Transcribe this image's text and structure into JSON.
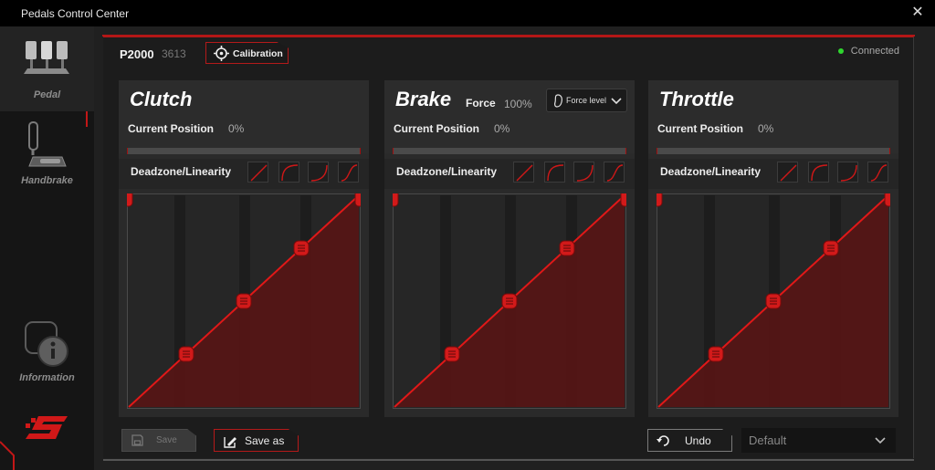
{
  "window": {
    "title": "Pedals Control Center",
    "close_icon": "close-icon"
  },
  "sidebar": {
    "items": [
      {
        "label": "Pedal",
        "icon": "pedals-icon",
        "active": true
      },
      {
        "label": "Handbrake",
        "icon": "handbrake-icon",
        "active": false
      },
      {
        "label": "Information",
        "icon": "information-icon",
        "active": false
      }
    ],
    "logo": "brand-logo"
  },
  "header": {
    "model": "P2000",
    "serial": "3613",
    "calibration_label": "Calibration",
    "status": "Connected",
    "status_color": "#2fd62f"
  },
  "panels": [
    {
      "title": "Clutch",
      "position_label": "Current Position",
      "position_value": "0%",
      "deadzone_label": "Deadzone/Linearity"
    },
    {
      "title": "Brake",
      "position_label": "Current Position",
      "position_value": "0%",
      "deadzone_label": "Deadzone/Linearity",
      "force_label": "Force",
      "force_value": "100%",
      "force_level_label": "Force level"
    },
    {
      "title": "Throttle",
      "position_label": "Current Position",
      "position_value": "0%",
      "deadzone_label": "Deadzone/Linearity"
    }
  ],
  "footer": {
    "save_label": "Save",
    "save_as_label": "Save as",
    "undo_label": "Undo",
    "preset_value": "Default"
  },
  "colors": {
    "accent": "#c8161b",
    "background": "#202020",
    "panel": "#2a2a2a"
  }
}
